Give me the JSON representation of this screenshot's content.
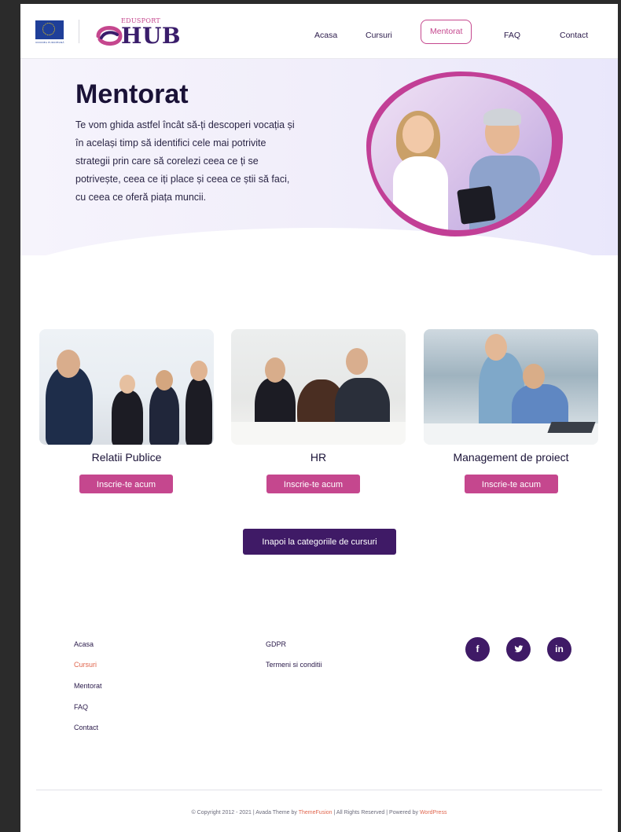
{
  "header": {
    "eu_caption": "UNIUNEA EUROPEANĂ",
    "logo_small": "EDUSPORT",
    "logo_big": "HUB",
    "nav": [
      {
        "label": "Acasa",
        "active": false
      },
      {
        "label": "Cursuri",
        "active": false
      },
      {
        "label": "Mentorat",
        "active": true
      },
      {
        "label": "FAQ",
        "active": false
      },
      {
        "label": "Contact",
        "active": false
      }
    ]
  },
  "hero": {
    "title": "Mentorat",
    "text": "Te vom ghida astfel încât să-ți descoperi vocația și în același timp să identifici cele mai potrivite strategii prin care să corelezi ceea ce ți se potrivește, ceea ce iți place și ceea ce știi să faci, cu ceea ce oferă piața muncii."
  },
  "cards": [
    {
      "title": "Relatii Publice",
      "button": "Inscrie-te acum"
    },
    {
      "title": "HR",
      "button": "Inscrie-te acum"
    },
    {
      "title": "Management de proiect",
      "button": "Inscrie-te acum"
    }
  ],
  "back_button": "Inapoi la categoriile de cursuri",
  "footer": {
    "col1": [
      "Acasa",
      "Cursuri",
      "Mentorat",
      "FAQ",
      "Contact"
    ],
    "col2": [
      "GDPR",
      "Termeni si conditii"
    ],
    "social": [
      {
        "icon": "facebook-icon",
        "glyph": "f"
      },
      {
        "icon": "twitter-icon",
        "glyph": "🐦"
      },
      {
        "icon": "linkedin-icon",
        "glyph": "in"
      }
    ],
    "copyright_pre": "© Copyright 2012 - 2021 | Avada Theme by ",
    "copyright_link1": "ThemeFusion",
    "copyright_mid": " | All Rights Reserved | Powered by ",
    "copyright_link2": "WordPress"
  },
  "colors": {
    "accent": "#c5478e",
    "primary_dark": "#3f1a66",
    "link_highlight": "#e0664e"
  }
}
